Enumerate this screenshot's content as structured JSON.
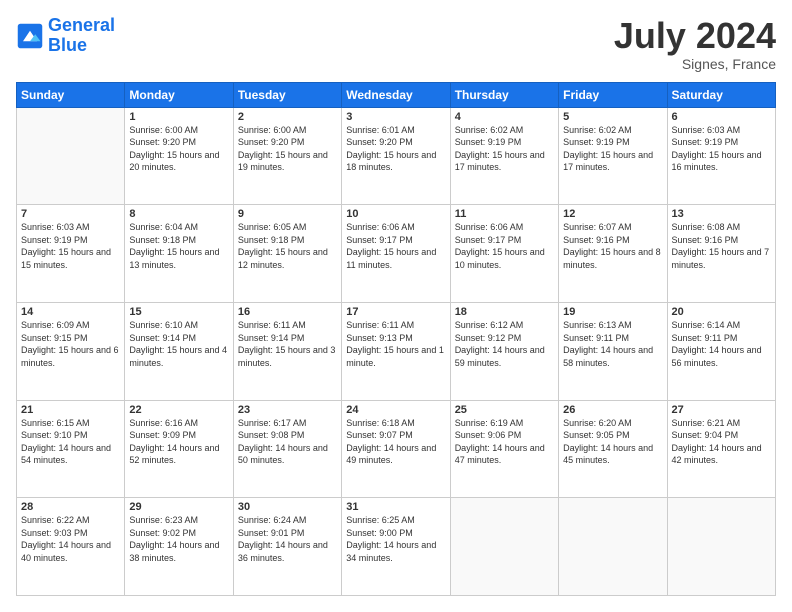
{
  "header": {
    "logo_line1": "General",
    "logo_line2": "Blue",
    "month": "July 2024",
    "location": "Signes, France"
  },
  "days_of_week": [
    "Sunday",
    "Monday",
    "Tuesday",
    "Wednesday",
    "Thursday",
    "Friday",
    "Saturday"
  ],
  "weeks": [
    [
      {
        "day": "",
        "sunrise": "",
        "sunset": "",
        "daylight": ""
      },
      {
        "day": "1",
        "sunrise": "Sunrise: 6:00 AM",
        "sunset": "Sunset: 9:20 PM",
        "daylight": "Daylight: 15 hours and 20 minutes."
      },
      {
        "day": "2",
        "sunrise": "Sunrise: 6:00 AM",
        "sunset": "Sunset: 9:20 PM",
        "daylight": "Daylight: 15 hours and 19 minutes."
      },
      {
        "day": "3",
        "sunrise": "Sunrise: 6:01 AM",
        "sunset": "Sunset: 9:20 PM",
        "daylight": "Daylight: 15 hours and 18 minutes."
      },
      {
        "day": "4",
        "sunrise": "Sunrise: 6:02 AM",
        "sunset": "Sunset: 9:19 PM",
        "daylight": "Daylight: 15 hours and 17 minutes."
      },
      {
        "day": "5",
        "sunrise": "Sunrise: 6:02 AM",
        "sunset": "Sunset: 9:19 PM",
        "daylight": "Daylight: 15 hours and 17 minutes."
      },
      {
        "day": "6",
        "sunrise": "Sunrise: 6:03 AM",
        "sunset": "Sunset: 9:19 PM",
        "daylight": "Daylight: 15 hours and 16 minutes."
      }
    ],
    [
      {
        "day": "7",
        "sunrise": "Sunrise: 6:03 AM",
        "sunset": "Sunset: 9:19 PM",
        "daylight": "Daylight: 15 hours and 15 minutes."
      },
      {
        "day": "8",
        "sunrise": "Sunrise: 6:04 AM",
        "sunset": "Sunset: 9:18 PM",
        "daylight": "Daylight: 15 hours and 13 minutes."
      },
      {
        "day": "9",
        "sunrise": "Sunrise: 6:05 AM",
        "sunset": "Sunset: 9:18 PM",
        "daylight": "Daylight: 15 hours and 12 minutes."
      },
      {
        "day": "10",
        "sunrise": "Sunrise: 6:06 AM",
        "sunset": "Sunset: 9:17 PM",
        "daylight": "Daylight: 15 hours and 11 minutes."
      },
      {
        "day": "11",
        "sunrise": "Sunrise: 6:06 AM",
        "sunset": "Sunset: 9:17 PM",
        "daylight": "Daylight: 15 hours and 10 minutes."
      },
      {
        "day": "12",
        "sunrise": "Sunrise: 6:07 AM",
        "sunset": "Sunset: 9:16 PM",
        "daylight": "Daylight: 15 hours and 8 minutes."
      },
      {
        "day": "13",
        "sunrise": "Sunrise: 6:08 AM",
        "sunset": "Sunset: 9:16 PM",
        "daylight": "Daylight: 15 hours and 7 minutes."
      }
    ],
    [
      {
        "day": "14",
        "sunrise": "Sunrise: 6:09 AM",
        "sunset": "Sunset: 9:15 PM",
        "daylight": "Daylight: 15 hours and 6 minutes."
      },
      {
        "day": "15",
        "sunrise": "Sunrise: 6:10 AM",
        "sunset": "Sunset: 9:14 PM",
        "daylight": "Daylight: 15 hours and 4 minutes."
      },
      {
        "day": "16",
        "sunrise": "Sunrise: 6:11 AM",
        "sunset": "Sunset: 9:14 PM",
        "daylight": "Daylight: 15 hours and 3 minutes."
      },
      {
        "day": "17",
        "sunrise": "Sunrise: 6:11 AM",
        "sunset": "Sunset: 9:13 PM",
        "daylight": "Daylight: 15 hours and 1 minute."
      },
      {
        "day": "18",
        "sunrise": "Sunrise: 6:12 AM",
        "sunset": "Sunset: 9:12 PM",
        "daylight": "Daylight: 14 hours and 59 minutes."
      },
      {
        "day": "19",
        "sunrise": "Sunrise: 6:13 AM",
        "sunset": "Sunset: 9:11 PM",
        "daylight": "Daylight: 14 hours and 58 minutes."
      },
      {
        "day": "20",
        "sunrise": "Sunrise: 6:14 AM",
        "sunset": "Sunset: 9:11 PM",
        "daylight": "Daylight: 14 hours and 56 minutes."
      }
    ],
    [
      {
        "day": "21",
        "sunrise": "Sunrise: 6:15 AM",
        "sunset": "Sunset: 9:10 PM",
        "daylight": "Daylight: 14 hours and 54 minutes."
      },
      {
        "day": "22",
        "sunrise": "Sunrise: 6:16 AM",
        "sunset": "Sunset: 9:09 PM",
        "daylight": "Daylight: 14 hours and 52 minutes."
      },
      {
        "day": "23",
        "sunrise": "Sunrise: 6:17 AM",
        "sunset": "Sunset: 9:08 PM",
        "daylight": "Daylight: 14 hours and 50 minutes."
      },
      {
        "day": "24",
        "sunrise": "Sunrise: 6:18 AM",
        "sunset": "Sunset: 9:07 PM",
        "daylight": "Daylight: 14 hours and 49 minutes."
      },
      {
        "day": "25",
        "sunrise": "Sunrise: 6:19 AM",
        "sunset": "Sunset: 9:06 PM",
        "daylight": "Daylight: 14 hours and 47 minutes."
      },
      {
        "day": "26",
        "sunrise": "Sunrise: 6:20 AM",
        "sunset": "Sunset: 9:05 PM",
        "daylight": "Daylight: 14 hours and 45 minutes."
      },
      {
        "day": "27",
        "sunrise": "Sunrise: 6:21 AM",
        "sunset": "Sunset: 9:04 PM",
        "daylight": "Daylight: 14 hours and 42 minutes."
      }
    ],
    [
      {
        "day": "28",
        "sunrise": "Sunrise: 6:22 AM",
        "sunset": "Sunset: 9:03 PM",
        "daylight": "Daylight: 14 hours and 40 minutes."
      },
      {
        "day": "29",
        "sunrise": "Sunrise: 6:23 AM",
        "sunset": "Sunset: 9:02 PM",
        "daylight": "Daylight: 14 hours and 38 minutes."
      },
      {
        "day": "30",
        "sunrise": "Sunrise: 6:24 AM",
        "sunset": "Sunset: 9:01 PM",
        "daylight": "Daylight: 14 hours and 36 minutes."
      },
      {
        "day": "31",
        "sunrise": "Sunrise: 6:25 AM",
        "sunset": "Sunset: 9:00 PM",
        "daylight": "Daylight: 14 hours and 34 minutes."
      },
      {
        "day": "",
        "sunrise": "",
        "sunset": "",
        "daylight": ""
      },
      {
        "day": "",
        "sunrise": "",
        "sunset": "",
        "daylight": ""
      },
      {
        "day": "",
        "sunrise": "",
        "sunset": "",
        "daylight": ""
      }
    ]
  ]
}
